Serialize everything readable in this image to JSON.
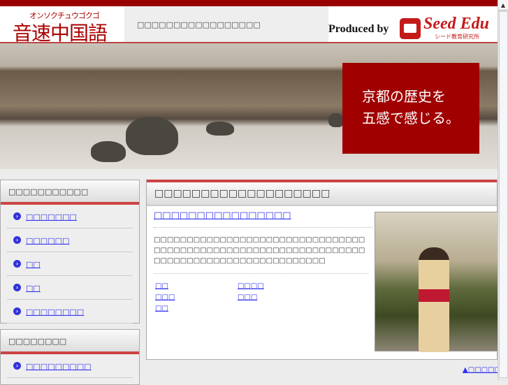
{
  "header": {
    "logo_kana": "オンソクチュウゴクゴ",
    "logo_text": "音速中国語",
    "tagline": "□□□□□□□□□□□□□□□□□",
    "produced_by": "Produced by",
    "producer_name": "Seed Edu",
    "producer_sub": "シード教育研究所"
  },
  "banner": {
    "line1": "京都の歴史を",
    "line2": "五感で感じる。"
  },
  "sidebar": {
    "box1": {
      "title": "□□□□□□□□□□□",
      "items": [
        {
          "label": "□□□□□□□"
        },
        {
          "label": "□□□□□□"
        },
        {
          "label": "□□"
        },
        {
          "label": "□□"
        },
        {
          "label": "□□□□□□□□"
        }
      ]
    },
    "box2": {
      "title": "□□□□□□□□",
      "items": [
        {
          "label": "□□□□□□□□□"
        }
      ]
    }
  },
  "main": {
    "heading": "□□□□□□□□□□□□□□□□□□□",
    "article_title": "□□□□□□□□□□□□□□□□",
    "paragraph": "□□□□□□□□□□□□□□□□□□□□□□□□□□□□□□□□□□□□□□□□□□□□□□□□□□□□□□□□□□□□□□□□□□□□□□□□□□□□□□□□□□□□□□□□□□",
    "links": [
      {
        "label": "□□"
      },
      {
        "label": "□□□□"
      },
      {
        "label": "□□□"
      },
      {
        "label": "□□□"
      },
      {
        "label": "□□"
      }
    ]
  },
  "footer": {
    "back_to_top": "▲□□□□□□□"
  },
  "colors": {
    "brand_red": "#990000",
    "accent_red": "#cc4444",
    "link": "#3333ee"
  }
}
